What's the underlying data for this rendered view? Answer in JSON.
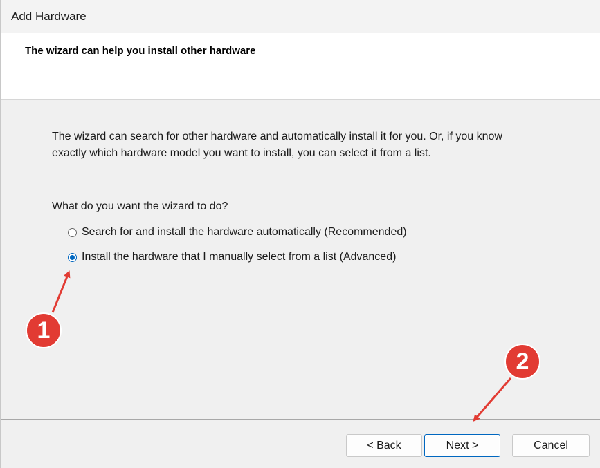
{
  "window": {
    "title": "Add Hardware"
  },
  "header": {
    "title": "The wizard can help you install other hardware"
  },
  "body": {
    "description_line1": "The wizard can search for other hardware and automatically install it for you. Or, if you know",
    "description_line2": "exactly which hardware model you want to install, you can select it from a list.",
    "question": "What do you want the wizard to do?",
    "options": [
      {
        "label": "Search for and install the hardware automatically (Recommended)",
        "selected": false
      },
      {
        "label": "Install the hardware that I manually select from a list (Advanced)",
        "selected": true
      }
    ]
  },
  "buttons": {
    "back": "< Back",
    "next": "Next >",
    "cancel": "Cancel"
  },
  "annotations": {
    "badge1": "1",
    "badge2": "2",
    "color": "#e23b33"
  },
  "colors": {
    "accent": "#0067c0",
    "background": "#f0f0f0"
  }
}
